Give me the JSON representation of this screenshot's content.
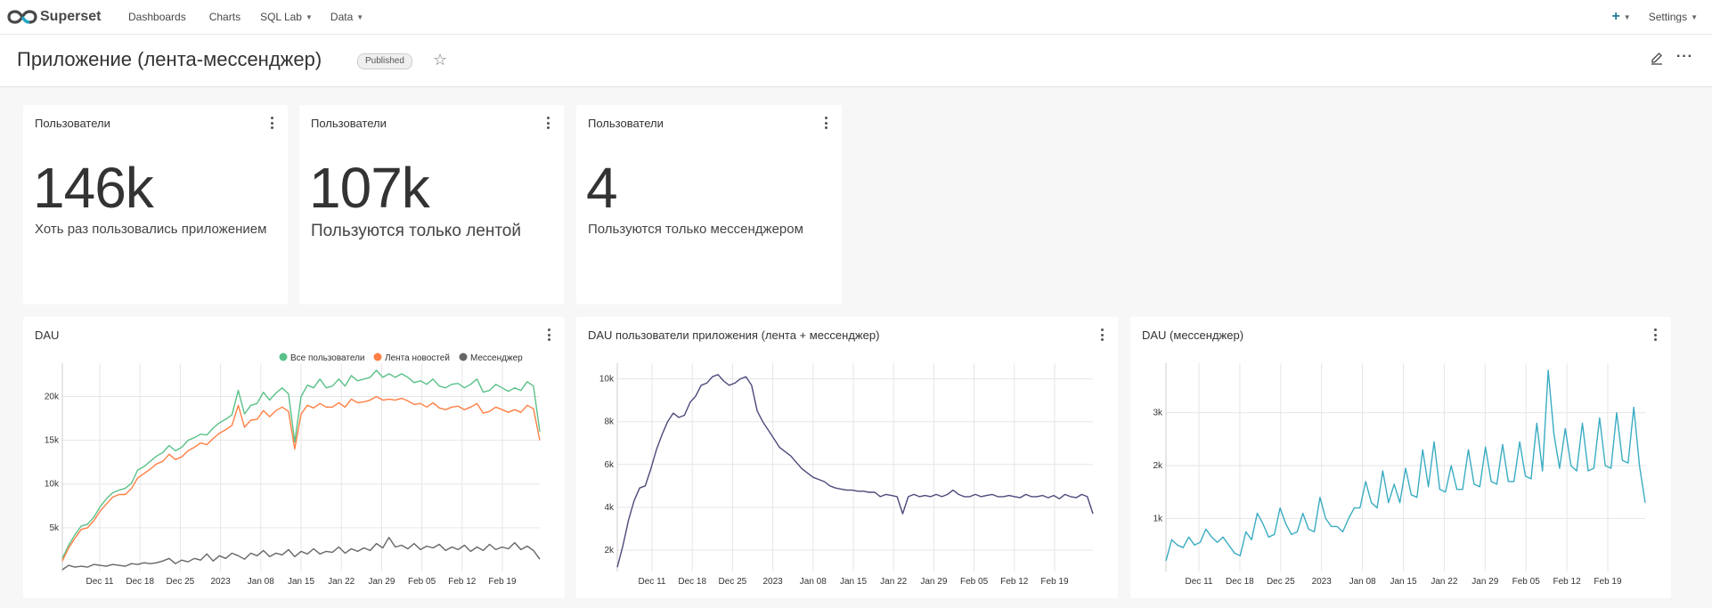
{
  "nav": {
    "brand": "Superset",
    "items": [
      {
        "label": "Dashboards",
        "caret": false
      },
      {
        "label": "Charts",
        "caret": false
      },
      {
        "label": "SQL Lab",
        "caret": true
      },
      {
        "label": "Data",
        "caret": true
      }
    ],
    "plus_icon": "plus-icon",
    "settings": "Settings"
  },
  "header": {
    "title": "Приложение (лента-мессенджер)",
    "status": "Published",
    "favorite_icon": "star-icon",
    "edit_icon": "pencil-icon",
    "more_icon": "more-horizontal-icon"
  },
  "big_numbers": [
    {
      "title": "Пользователи",
      "value": "146k",
      "subheader": "Хоть раз пользовались приложением"
    },
    {
      "title": "Пользователи",
      "value": "107k",
      "subheader": "Пользуются только лентой"
    },
    {
      "title": "Пользователи",
      "value": "4",
      "subheader": "Пользуются только мессенджером"
    }
  ],
  "chart_data": [
    {
      "type": "line",
      "title": "DAU",
      "x_ticks": [
        "Dec 11",
        "Dec 18",
        "Dec 25",
        "2023",
        "Jan 08",
        "Jan 15",
        "Jan 22",
        "Jan 29",
        "Feb 05",
        "Feb 12",
        "Feb 19"
      ],
      "y_ticks": [
        "5k",
        "10k",
        "15k",
        "20k"
      ],
      "ylim": [
        0,
        23000
      ],
      "legend_position": "top-right",
      "series": [
        {
          "name": "Все пользователи",
          "color": "#5AC189",
          "values": [
            1500,
            3000,
            4200,
            5200,
            5400,
            6200,
            7400,
            8300,
            9000,
            9300,
            9500,
            10100,
            11600,
            12000,
            12600,
            13200,
            13600,
            14400,
            13800,
            14200,
            15000,
            15300,
            15700,
            15600,
            16400,
            17000,
            17400,
            17900,
            20700,
            18000,
            19000,
            19200,
            20500,
            19600,
            20400,
            21000,
            20300,
            14800,
            20000,
            21300,
            21000,
            22000,
            21000,
            21200,
            22000,
            21200,
            22400,
            21800,
            22000,
            22200,
            23000,
            22200,
            22600,
            22200,
            22600,
            22200,
            21600,
            21800,
            21400,
            22000,
            21200,
            21000,
            21400,
            21500,
            21000,
            21400,
            22000,
            20500,
            20700,
            21400,
            21000,
            20600,
            21000,
            20700,
            21700,
            21200,
            16000
          ]
        },
        {
          "name": "Лента новостей",
          "color": "#FF7F44",
          "values": [
            1200,
            2700,
            3800,
            4800,
            5000,
            5800,
            6900,
            7700,
            8500,
            8800,
            8800,
            9500,
            10700,
            11200,
            11700,
            12300,
            12600,
            13400,
            12800,
            13100,
            13800,
            14200,
            14700,
            14500,
            15200,
            15800,
            16200,
            16700,
            19000,
            16500,
            17300,
            17400,
            18400,
            17700,
            18400,
            18800,
            18300,
            14000,
            18000,
            19000,
            18700,
            19200,
            18800,
            18800,
            19300,
            18800,
            19700,
            19300,
            19400,
            19600,
            20000,
            19600,
            19700,
            19600,
            19800,
            19500,
            19100,
            19200,
            18800,
            19300,
            18700,
            18500,
            18800,
            18900,
            18500,
            18800,
            19200,
            18100,
            18300,
            18800,
            18500,
            18200,
            18500,
            18200,
            19000,
            18600,
            15000
          ]
        },
        {
          "name": "Мессенджер",
          "color": "#666666",
          "values": [
            200,
            700,
            500,
            600,
            500,
            800,
            700,
            600,
            800,
            700,
            600,
            900,
            800,
            1000,
            900,
            1000,
            1200,
            1500,
            900,
            1300,
            1100,
            1500,
            1300,
            2000,
            1200,
            1800,
            1500,
            2100,
            1800,
            1400,
            2100,
            1800,
            2400,
            1700,
            2100,
            1900,
            2500,
            1700,
            2300,
            2000,
            2600,
            2000,
            2300,
            2200,
            2800,
            2100,
            2600,
            2300,
            2700,
            2400,
            3200,
            2700,
            3900,
            2800,
            3000,
            2600,
            3200,
            2500,
            2900,
            2700,
            3100,
            2400,
            2800,
            2500,
            3000,
            2300,
            2800,
            2400,
            3100,
            2500,
            2800,
            2600,
            3300,
            2500,
            2900,
            2400,
            1400
          ]
        }
      ]
    },
    {
      "type": "line",
      "title": "DAU пользователи приложения (лента + мессенджер)",
      "x_ticks": [
        "Dec 11",
        "Dec 18",
        "Dec 25",
        "2023",
        "Jan 08",
        "Jan 15",
        "Jan 22",
        "Jan 29",
        "Feb 05",
        "Feb 12",
        "Feb 19"
      ],
      "y_ticks": [
        "2k",
        "4k",
        "6k",
        "8k",
        "10k"
      ],
      "ylim": [
        1000,
        10400
      ],
      "series": [
        {
          "name": "",
          "color": "#4B4A7B",
          "values": [
            1200,
            2200,
            3400,
            4300,
            4900,
            5000,
            5800,
            6700,
            7400,
            8000,
            8400,
            8200,
            8300,
            8900,
            9200,
            9700,
            9800,
            10100,
            10200,
            9900,
            9700,
            9800,
            10000,
            10100,
            9700,
            8500,
            8000,
            7600,
            7200,
            6800,
            6600,
            6400,
            6100,
            5800,
            5600,
            5400,
            5300,
            5200,
            5000,
            4900,
            4850,
            4800,
            4800,
            4750,
            4750,
            4700,
            4700,
            4500,
            4600,
            4550,
            4500,
            3700,
            4500,
            4600,
            4500,
            4550,
            4500,
            4600,
            4500,
            4600,
            4800,
            4600,
            4500,
            4500,
            4600,
            4500,
            4550,
            4600,
            4500,
            4500,
            4550,
            4500,
            4450,
            4600,
            4500,
            4500,
            4550,
            4450,
            4550,
            4400,
            4600,
            4500,
            4450,
            4600,
            4500,
            3700
          ]
        }
      ]
    },
    {
      "type": "line",
      "title": "DAU (мессенджер)",
      "x_ticks": [
        "Dec 11",
        "Dec 18",
        "Dec 25",
        "2023",
        "Jan 08",
        "Jan 15",
        "Jan 22",
        "Jan 29",
        "Feb 05",
        "Feb 12",
        "Feb 19"
      ],
      "y_ticks": [
        "1k",
        "2k",
        "3k"
      ],
      "ylim": [
        0,
        3800
      ],
      "series": [
        {
          "name": "",
          "color": "#3AACC2",
          "values": [
            200,
            600,
            500,
            450,
            650,
            500,
            550,
            800,
            650,
            550,
            650,
            500,
            350,
            300,
            750,
            600,
            1100,
            900,
            650,
            700,
            1200,
            900,
            700,
            750,
            1100,
            800,
            750,
            1400,
            1000,
            850,
            850,
            750,
            1000,
            1200,
            1200,
            1700,
            1300,
            1200,
            1900,
            1300,
            1650,
            1300,
            1950,
            1450,
            1400,
            2300,
            1600,
            2450,
            1550,
            1500,
            2000,
            1550,
            1550,
            2300,
            1650,
            1600,
            2350,
            1700,
            1650,
            2400,
            1700,
            1700,
            2450,
            1800,
            1750,
            2800,
            1900,
            3800,
            2600,
            1950,
            2700,
            2000,
            1900,
            2800,
            1900,
            1950,
            2900,
            2000,
            1950,
            3000,
            2100,
            2050,
            3100,
            2000,
            1300
          ]
        }
      ]
    }
  ]
}
